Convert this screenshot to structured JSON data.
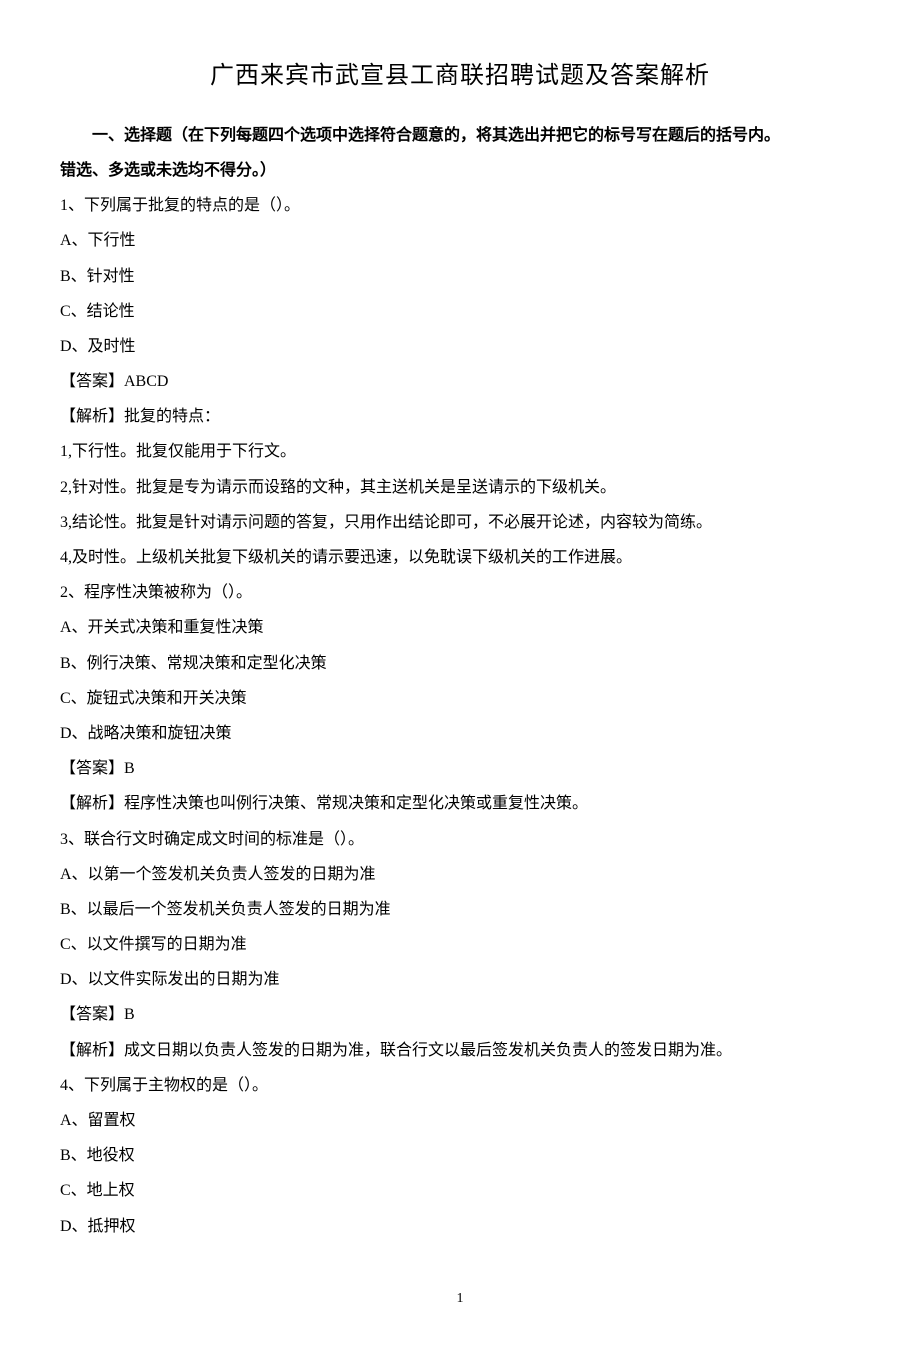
{
  "title": "广西来宾市武宣县工商联招聘试题及答案解析",
  "section": {
    "header_line1": "一、选择题（在下列每题四个选项中选择符合题意的，将其选出并把它的标号写在题后的括号内。",
    "header_line2": "错选、多选或未选均不得分。）"
  },
  "q1": {
    "stem": "1、下列属于批复的特点的是（）。",
    "optA": "A、下行性",
    "optB": "B、针对性",
    "optC": "C、结论性",
    "optD": "D、及时性",
    "answer": "【答案】ABCD",
    "explain_head": "【解析】批复的特点：",
    "explain_1": "1,下行性。批复仅能用于下行文。",
    "explain_2": "2,针对性。批复是专为请示而设臵的文种，其主送机关是呈送请示的下级机关。",
    "explain_3": "3,结论性。批复是针对请示问题的答复，只用作出结论即可，不必展开论述，内容较为简练。",
    "explain_4": "4,及时性。上级机关批复下级机关的请示要迅速，以免耽误下级机关的工作进展。"
  },
  "q2": {
    "stem": "2、程序性决策被称为（）。",
    "optA": "A、开关式决策和重复性决策",
    "optB": "B、例行决策、常规决策和定型化决策",
    "optC": "C、旋钮式决策和开关决策",
    "optD": "D、战略决策和旋钮决策",
    "answer": "【答案】B",
    "explain": "【解析】程序性决策也叫例行决策、常规决策和定型化决策或重复性决策。"
  },
  "q3": {
    "stem": "3、联合行文时确定成文时间的标准是（）。",
    "optA": "A、以第一个签发机关负责人签发的日期为准",
    "optB": "B、以最后一个签发机关负责人签发的日期为准",
    "optC": "C、以文件撰写的日期为准",
    "optD": "D、以文件实际发出的日期为准",
    "answer": "【答案】B",
    "explain": "【解析】成文日期以负责人签发的日期为准，联合行文以最后签发机关负责人的签发日期为准。"
  },
  "q4": {
    "stem": "4、下列属于主物权的是（）。",
    "optA": "A、留置权",
    "optB": "B、地役权",
    "optC": "C、地上权",
    "optD": "D、抵押权"
  },
  "page_number": "1"
}
